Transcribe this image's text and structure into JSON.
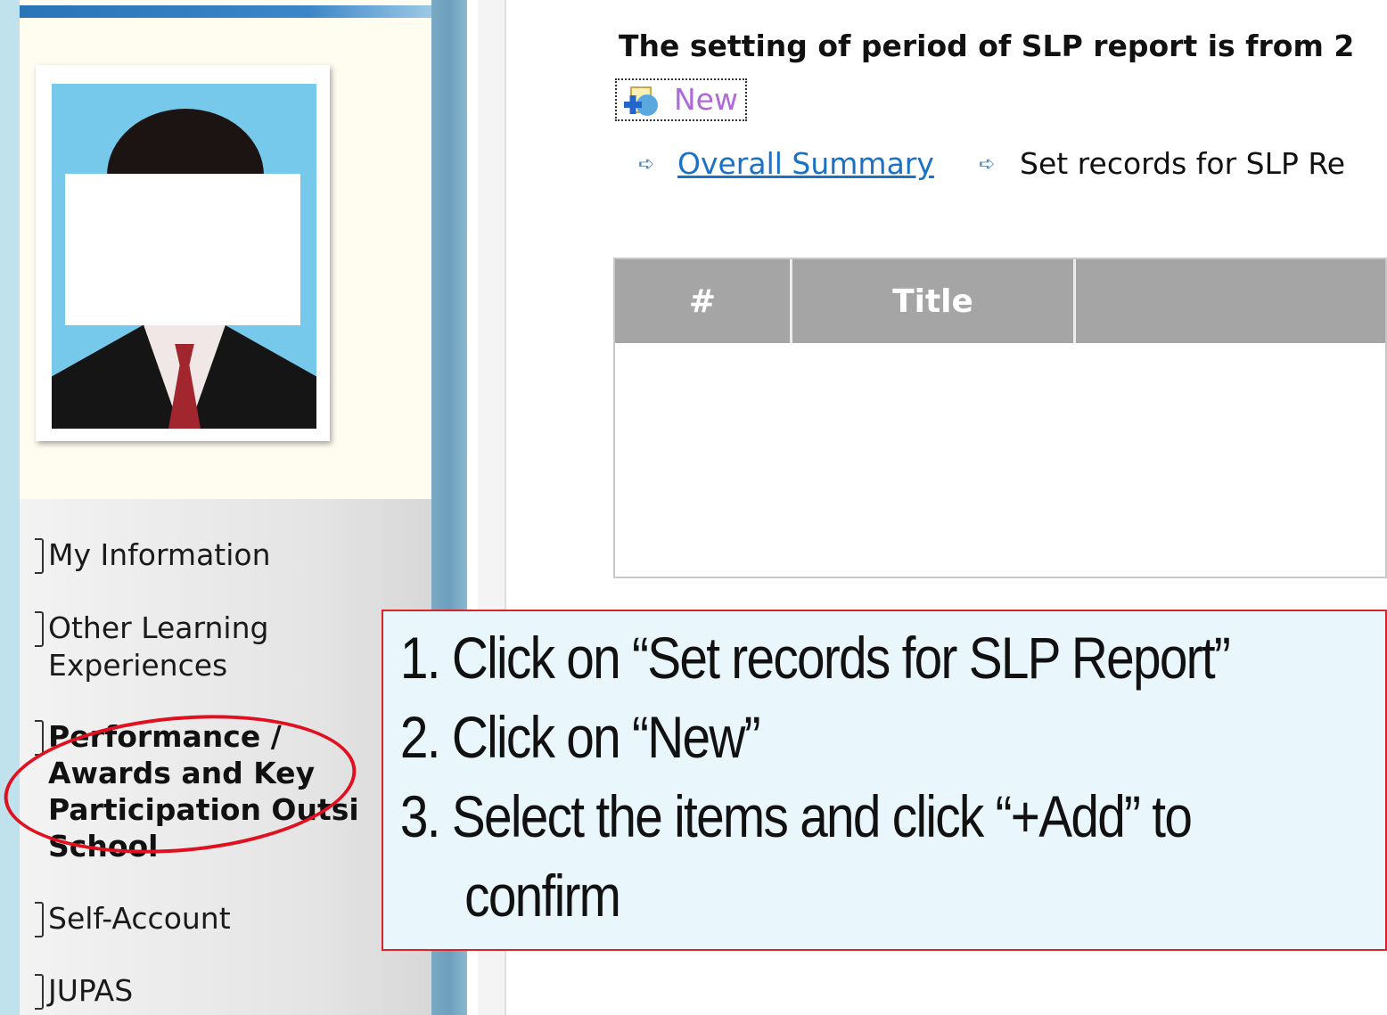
{
  "heading": "The setting of period of SLP report is from 2",
  "toolbar": {
    "new_label": "New"
  },
  "breadcrumb": {
    "overall_summary": "Overall Summary",
    "current": "Set records for SLP Re"
  },
  "table": {
    "headers": [
      "#",
      "Title",
      ""
    ]
  },
  "menu": {
    "items": [
      {
        "label": "My Information"
      },
      {
        "label_line1": "Other Learning",
        "label_line2": "Experiences"
      },
      {
        "label_line1": "Performance /",
        "label_line2": "Awards and Key",
        "label_line3": "Participation Outsi",
        "label_line4": "School"
      },
      {
        "label": "Self-Account"
      },
      {
        "label": "JUPAS"
      }
    ]
  },
  "callout": {
    "steps": [
      "1. Click on “Set records for SLP Report”",
      "2. Click on “New”",
      "3. Select the items and click “+Add” to",
      "confirm"
    ]
  },
  "colors": {
    "callout_border": "#d9242b",
    "highlight_ellipse": "#e01020",
    "link": "#1a72c6",
    "new_link": "#b06ad8",
    "table_header": "#a5a5a5"
  }
}
